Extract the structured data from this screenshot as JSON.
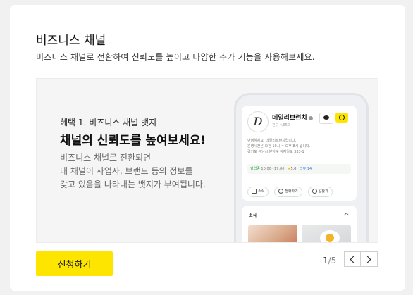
{
  "section": {
    "title": "비즈니스 채널",
    "description": "비즈니스 채널로 전환하여 신뢰도를 높이고 다양한 추가 기능을 사용해보세요."
  },
  "banner": {
    "label": "혜택 1. 비즈니스 채널 뱃지",
    "headline": "채널의 신뢰도를 높여보세요!",
    "body_lines": [
      "비즈니스 채널로 전환되면",
      "내 채널이 사업자, 브랜드 등의 정보를",
      "갖고 있음을 나타내는 뱃지가 부여됩니다."
    ]
  },
  "phone": {
    "logo_letter": "D",
    "channel_name": "데일리브런치",
    "friends": "친구 4,650",
    "intro_lines": [
      "안녕하세요. 데일리브런치입니다.",
      "운영시간은 오전 10시 ~ 오후 8시 입니다.",
      "경기도 성남시 분당구 정자일로 333-1"
    ],
    "open_status": "영업중",
    "open_hours": "10:00~17:00",
    "rating": "5.0",
    "review": "리뷰 14",
    "actions": [
      "소식",
      "전화하기",
      "길찾기"
    ],
    "news_title": "소식"
  },
  "footer": {
    "apply_label": "신청하기",
    "page_current": "1",
    "page_total": "/5"
  }
}
